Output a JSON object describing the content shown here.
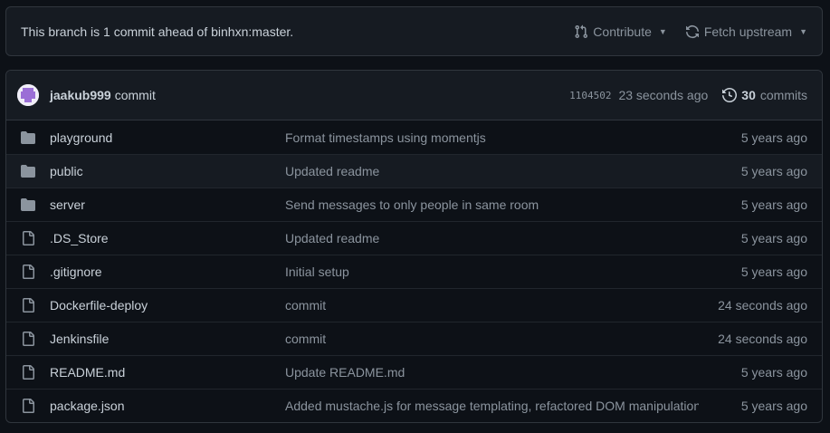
{
  "branch": {
    "status": "This branch is 1 commit ahead of binhxn:master.",
    "contribute_label": "Contribute",
    "fetch_label": "Fetch upstream"
  },
  "latest_commit": {
    "author": "jaakub999",
    "message": "commit",
    "sha": "1104502",
    "time": "23 seconds ago",
    "commits_count": "30",
    "commits_label": "commits"
  },
  "files": [
    {
      "type": "dir",
      "name": "playground",
      "message": "Format timestamps using momentjs",
      "age": "5 years ago"
    },
    {
      "type": "dir",
      "name": "public",
      "message": "Updated readme",
      "age": "5 years ago"
    },
    {
      "type": "dir",
      "name": "server",
      "message": "Send messages to only people in same room",
      "age": "5 years ago"
    },
    {
      "type": "file",
      "name": ".DS_Store",
      "message": "Updated readme",
      "age": "5 years ago"
    },
    {
      "type": "file",
      "name": ".gitignore",
      "message": "Initial setup",
      "age": "5 years ago"
    },
    {
      "type": "file",
      "name": "Dockerfile-deploy",
      "message": "commit",
      "age": "24 seconds ago"
    },
    {
      "type": "file",
      "name": "Jenkinsfile",
      "message": "commit",
      "age": "24 seconds ago"
    },
    {
      "type": "file",
      "name": "README.md",
      "message": "Update README.md",
      "age": "5 years ago"
    },
    {
      "type": "file",
      "name": "package.json",
      "message": "Added mustache.js for message templating, refactored DOM manipulation",
      "age": "5 years ago"
    }
  ],
  "colors": {
    "background": "#0d1117",
    "panel": "#161b22",
    "border": "#30363d",
    "text": "#c9d1d9",
    "muted": "#8b949e",
    "folder_icon": "#8b949e"
  }
}
